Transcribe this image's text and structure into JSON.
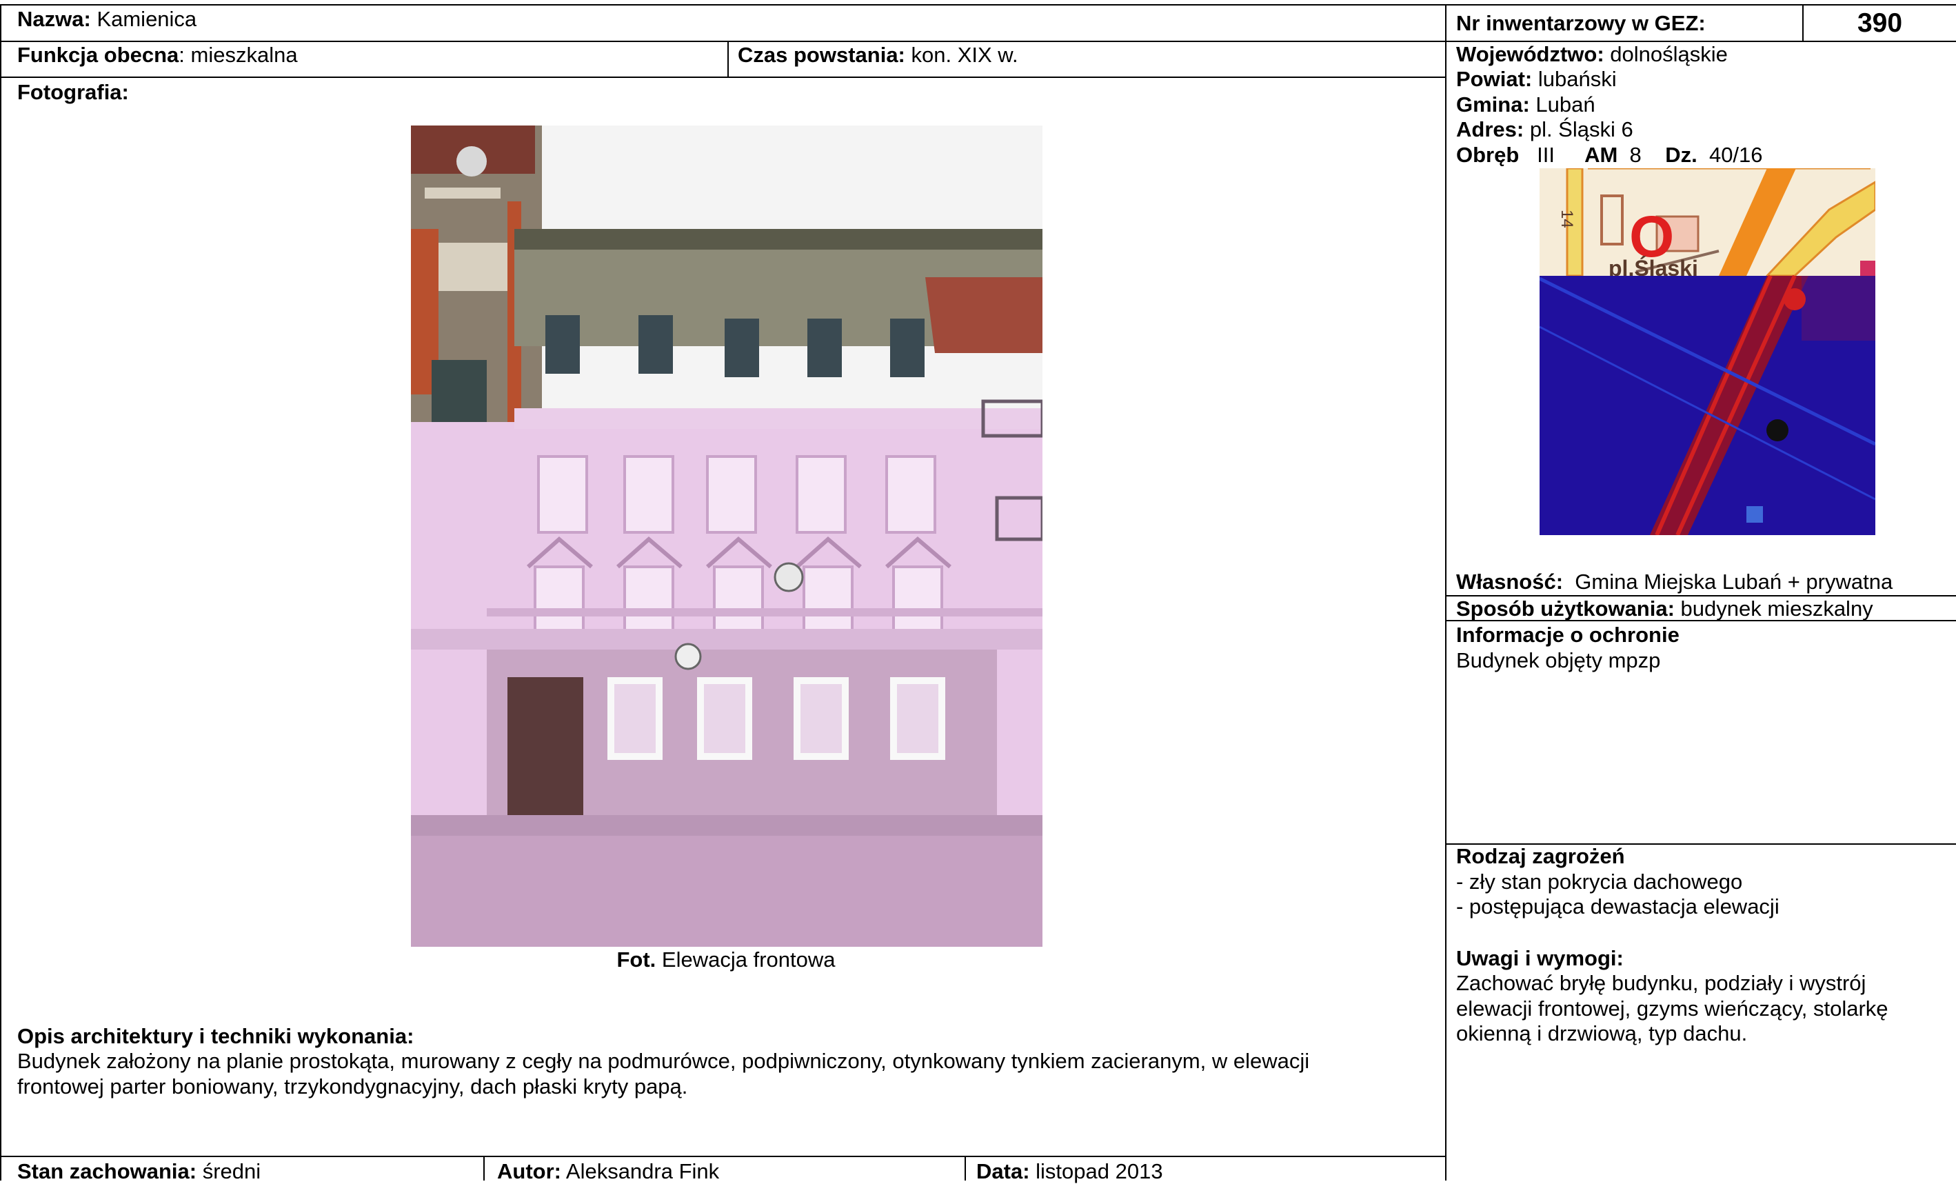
{
  "name": {
    "label": "Nazwa:",
    "value": "Kamienica"
  },
  "inventory": {
    "label": "Nr inwentarzowy w GEZ:",
    "value": "390"
  },
  "function": {
    "label": "Funkcja obecna",
    "value": ": mieszkalna"
  },
  "created": {
    "label": "Czas powstania:",
    "value": "kon. XIX w."
  },
  "location": {
    "voivodeship": {
      "label": "Województwo:",
      "value": "dolnośląskie"
    },
    "county": {
      "label": "Powiat:",
      "value": "lubański"
    },
    "commune": {
      "label": "Gmina:",
      "value": "Lubań"
    },
    "address": {
      "label": "Adres:",
      "value": "pl. Śląski 6"
    },
    "precinct": {
      "label": "Obręb",
      "value": "III"
    },
    "am": {
      "label": "AM",
      "value": "8"
    },
    "plot": {
      "label": "Dz.",
      "value": "40/16"
    }
  },
  "map": {
    "number": "14",
    "square_label": "pl.Śląski",
    "marker": "O"
  },
  "photo": {
    "label": "Fotografia:",
    "caption_bold": "Fot.",
    "caption": "Elewacja frontowa"
  },
  "ownership": {
    "label": "Własność:",
    "value": "Gmina Miejska Lubań + prywatna"
  },
  "usage": {
    "label": "Sposób użytkowania:",
    "value": "budynek mieszkalny"
  },
  "protection": {
    "heading": "Informacje o ochronie",
    "text": "Budynek objęty mpzp"
  },
  "threats": {
    "heading": "Rodzaj zagrożeń",
    "items": [
      "- zły stan pokrycia dachowego",
      "- postępująca dewastacja elewacji"
    ]
  },
  "remarks": {
    "heading": "Uwagi i wymogi:",
    "lines": [
      "Zachować bryłę budynku, podziały i wystrój",
      "elewacji frontowej, gzyms wieńczący, stolarkę",
      "okienną i drzwiową, typ dachu."
    ]
  },
  "description": {
    "heading": "Opis architektury i techniki wykonania:",
    "lines": [
      "Budynek założony na planie prostokąta, murowany z cegły na podmurówce, podpiwniczony, otynkowany tynkiem zacieranym, w elewacji",
      "frontowej parter boniowany, trzykondygnacyjny, dach płaski kryty papą."
    ]
  },
  "condition": {
    "label": "Stan zachowania:",
    "value": "średni"
  },
  "author": {
    "label": "Autor:",
    "value": "Aleksandra Fink"
  },
  "date": {
    "label": "Data:",
    "value": "listopad 2013"
  }
}
